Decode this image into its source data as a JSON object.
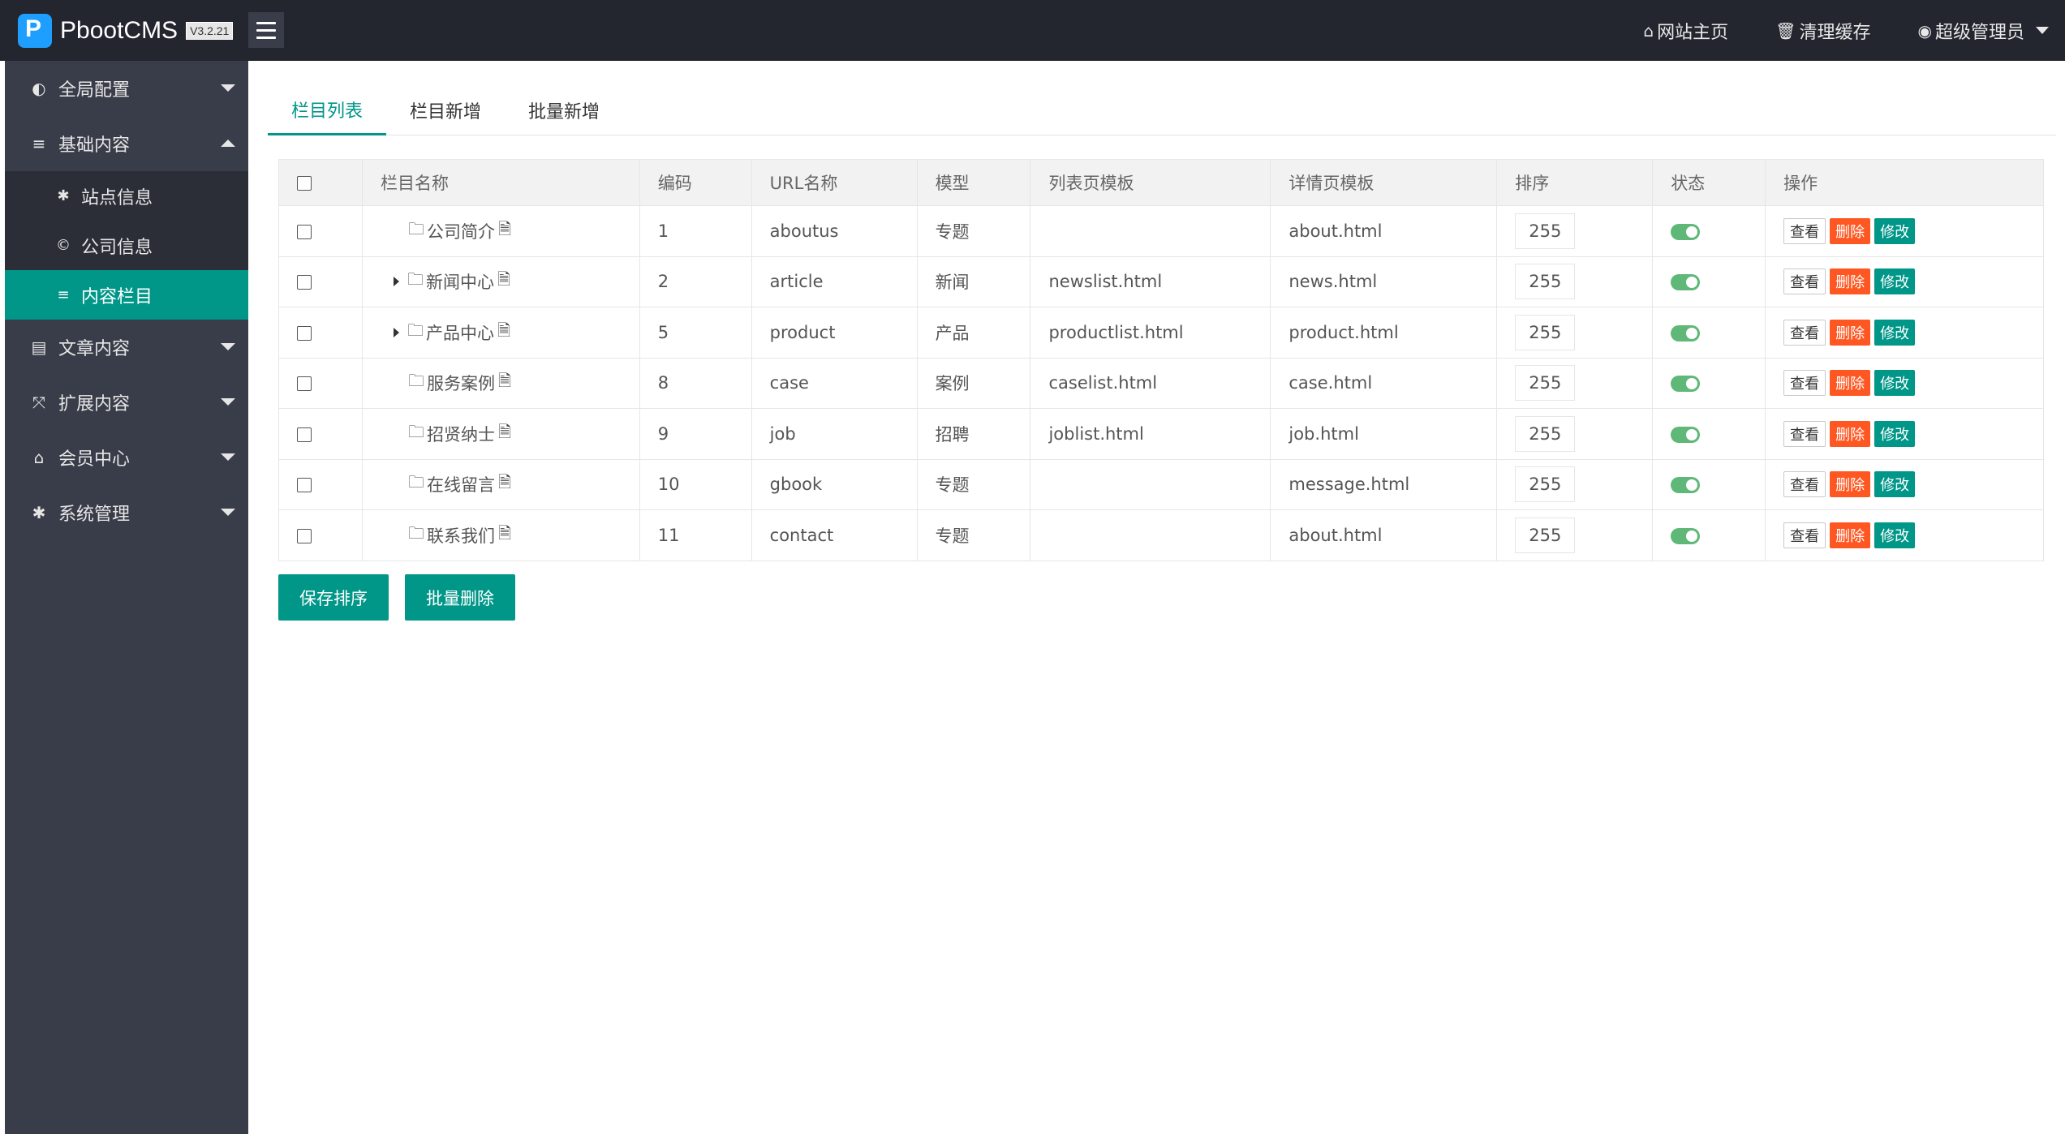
{
  "header": {
    "logo_text": "PbootCMS",
    "version": "V3.2.21",
    "links": [
      {
        "icon": "home-icon",
        "glyph": "⌂",
        "label": "网站主页"
      },
      {
        "icon": "trash-icon",
        "glyph": "🗑",
        "label": "清理缓存"
      },
      {
        "icon": "user-icon",
        "glyph": "◉",
        "label": "超级管理员"
      }
    ]
  },
  "sidebar": {
    "items": [
      {
        "label": "全局配置",
        "glyph": "◐",
        "icon": "globe-icon"
      },
      {
        "label": "基础内容",
        "glyph": "≡",
        "icon": "sliders-icon",
        "expanded": true
      },
      {
        "label": "文章内容",
        "glyph": "▤",
        "icon": "file-icon"
      },
      {
        "label": "扩展内容",
        "glyph": "⤧",
        "icon": "expand-icon"
      },
      {
        "label": "会员中心",
        "glyph": "⌂",
        "icon": "lock-icon"
      },
      {
        "label": "系统管理",
        "glyph": "✱",
        "icon": "cog-icon"
      }
    ],
    "sub_items": [
      {
        "label": "站点信息",
        "glyph": "✱",
        "icon": "cog-icon"
      },
      {
        "label": "公司信息",
        "glyph": "©",
        "icon": "copyright-icon"
      },
      {
        "label": "内容栏目",
        "glyph": "≡",
        "icon": "list-icon",
        "active": true
      }
    ]
  },
  "tabs": [
    {
      "label": "栏目列表",
      "active": true
    },
    {
      "label": "栏目新增"
    },
    {
      "label": "批量新增"
    }
  ],
  "table": {
    "headers": [
      "栏目名称",
      "编码",
      "URL名称",
      "模型",
      "列表页模板",
      "详情页模板",
      "排序",
      "状态",
      "操作"
    ],
    "rows": [
      {
        "name": "公司简介",
        "expandable": false,
        "code": "1",
        "url": "aboutus",
        "model": "专题",
        "list_tpl": "",
        "detail_tpl": "about.html",
        "sort": "255"
      },
      {
        "name": "新闻中心",
        "expandable": true,
        "code": "2",
        "url": "article",
        "model": "新闻",
        "list_tpl": "newslist.html",
        "detail_tpl": "news.html",
        "sort": "255"
      },
      {
        "name": "产品中心",
        "expandable": true,
        "code": "5",
        "url": "product",
        "model": "产品",
        "list_tpl": "productlist.html",
        "detail_tpl": "product.html",
        "sort": "255"
      },
      {
        "name": "服务案例",
        "expandable": false,
        "code": "8",
        "url": "case",
        "model": "案例",
        "list_tpl": "caselist.html",
        "detail_tpl": "case.html",
        "sort": "255"
      },
      {
        "name": "招贤纳士",
        "expandable": false,
        "code": "9",
        "url": "job",
        "model": "招聘",
        "list_tpl": "joblist.html",
        "detail_tpl": "job.html",
        "sort": "255"
      },
      {
        "name": "在线留言",
        "expandable": false,
        "code": "10",
        "url": "gbook",
        "model": "专题",
        "list_tpl": "",
        "detail_tpl": "message.html",
        "sort": "255"
      },
      {
        "name": "联系我们",
        "expandable": false,
        "code": "11",
        "url": "contact",
        "model": "专题",
        "list_tpl": "",
        "detail_tpl": "about.html",
        "sort": "255"
      }
    ],
    "ops": {
      "view": "查看",
      "delete": "删除",
      "edit": "修改"
    }
  },
  "actions": {
    "save_sort": "保存排序",
    "batch_delete": "批量删除"
  },
  "colors": {
    "accent": "#009688",
    "danger": "#ff5722",
    "switch_on": "#5fb878",
    "sidebar": "#393d49",
    "header": "#23262e"
  }
}
